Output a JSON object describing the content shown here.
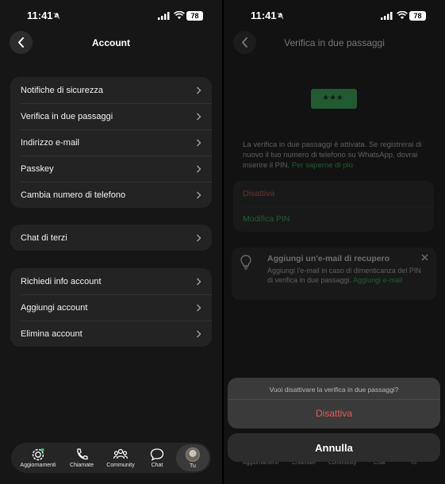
{
  "status": {
    "time": "11:41",
    "battery": "78"
  },
  "left": {
    "title": "Account",
    "groups": [
      {
        "items": [
          "Notifiche di sicurezza",
          "Verifica in due passaggi",
          "Indirizzo e-mail",
          "Passkey",
          "Cambia numero di telefono"
        ]
      },
      {
        "items": [
          "Chat di terzi"
        ]
      },
      {
        "items": [
          "Richiedi info account",
          "Aggiungi account",
          "Elimina account"
        ]
      }
    ],
    "tabs": [
      "Aggiornamenti",
      "Chiamate",
      "Community",
      "Chat",
      "Tu"
    ]
  },
  "right": {
    "title": "Verifica in due passaggi",
    "pin_mask": "***",
    "info_text": "La verifica in due passaggi è attivata. Se registrerai di nuovo il tuo numero di telefono su WhatsApp, dovrai inserire il PIN.",
    "info_link": "Per saperne di più",
    "actions": {
      "disable": "Disattiva",
      "change_pin": "Modifica PIN"
    },
    "recovery": {
      "title": "Aggiungi un'e-mail di recupero",
      "body": "Aggiungi l'e-mail in caso di dimenticanza del PIN di verifica in due passaggi.",
      "link": "Aggiungi e-mail"
    },
    "sheet": {
      "message": "Vuoi disattivare la verifica in due passaggi?",
      "destructive": "Disattiva",
      "cancel": "Annulla"
    },
    "tabs": [
      "Aggiornamenti",
      "Chiamate",
      "Community",
      "Chat",
      "Tu"
    ]
  },
  "colors": {
    "accent_green": "#3fbf60",
    "destructive_red": "#e85b55"
  }
}
